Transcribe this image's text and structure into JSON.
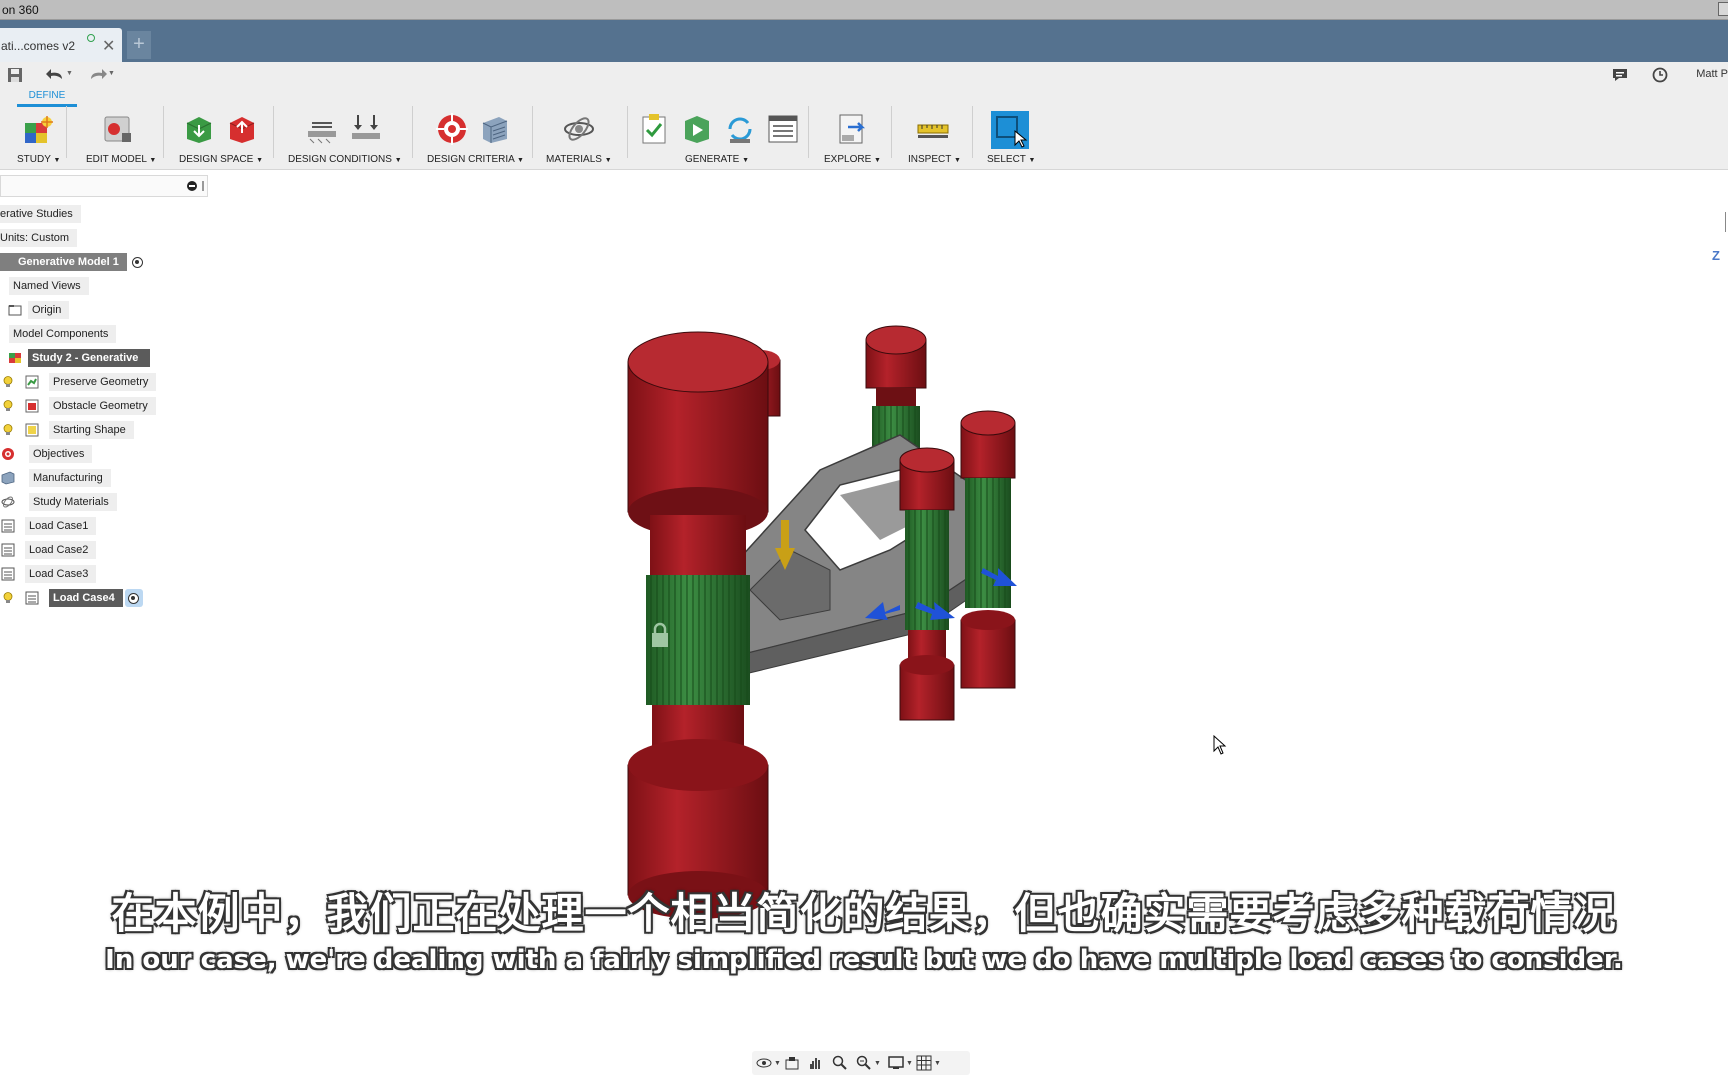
{
  "window": {
    "title": "on 360"
  },
  "document_tab": {
    "title": "ati...comes v2",
    "new_tab_label": "+"
  },
  "quick_access": {
    "user_name": "Matt P"
  },
  "ribbon": {
    "active_tab": "DEFINE",
    "groups": [
      {
        "label": "STUDY"
      },
      {
        "label": "EDIT MODEL"
      },
      {
        "label": "DESIGN SPACE"
      },
      {
        "label": "DESIGN CONDITIONS"
      },
      {
        "label": "DESIGN CRITERIA"
      },
      {
        "label": "MATERIALS"
      },
      {
        "label": "GENERATE"
      },
      {
        "label": "EXPLORE"
      },
      {
        "label": "INSPECT"
      },
      {
        "label": "SELECT"
      }
    ]
  },
  "browser": {
    "items": [
      {
        "label": "erative Studies"
      },
      {
        "label": "Units: Custom"
      },
      {
        "label": "Generative Model 1"
      },
      {
        "label": "Named Views"
      },
      {
        "label": "Origin"
      },
      {
        "label": "Model Components"
      },
      {
        "label": "Study 2 - Generative"
      },
      {
        "label": "Preserve Geometry"
      },
      {
        "label": "Obstacle Geometry"
      },
      {
        "label": "Starting Shape"
      },
      {
        "label": "Objectives"
      },
      {
        "label": "Manufacturing"
      },
      {
        "label": "Study Materials"
      },
      {
        "label": "Load Case1"
      },
      {
        "label": "Load Case2"
      },
      {
        "label": "Load Case3"
      },
      {
        "label": "Load Case4"
      }
    ]
  },
  "viewcube": {
    "axis_label": "Z"
  },
  "subtitles": {
    "chinese": "在本例中，我们正在处理一个相当简化的结果，但也确实需要考虑多种载荷情况",
    "english": "In our case, we're dealing with a fairly simplified result but we do have multiple load cases to consider."
  },
  "colors": {
    "tab_bar": "#55728f",
    "accent": "#1d8fd6",
    "obstacle_red": "#a3191f",
    "preserve_green": "#2f7d34",
    "body_gray": "#7a7a7a",
    "load_arrow_yellow": "#c9a016",
    "load_arrow_blue": "#1f52d8"
  }
}
